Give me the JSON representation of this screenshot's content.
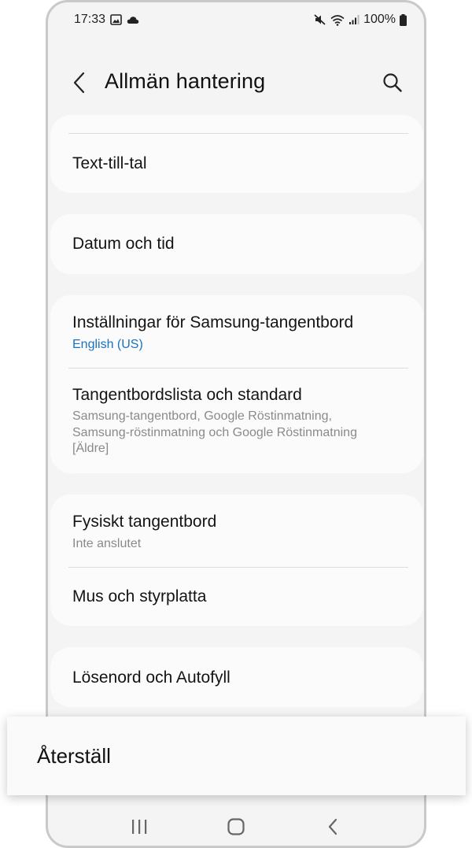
{
  "status_bar": {
    "time": "17:33",
    "battery": "100%",
    "left_icons": [
      "image-icon",
      "cloud-icon"
    ],
    "right_icons": [
      "mute-icon",
      "wifi-icon",
      "signal-icon",
      "battery-icon"
    ]
  },
  "header": {
    "title": "Allmän hantering",
    "back_icon": "chevron-left-icon",
    "search_icon": "search-icon"
  },
  "groups": [
    {
      "items": [
        {
          "title": "Text-till-tal"
        }
      ]
    },
    {
      "items": [
        {
          "title": "Datum och tid"
        }
      ]
    },
    {
      "items": [
        {
          "title": "Inställningar för Samsung-tangentbord",
          "subtitle": "English (US)"
        },
        {
          "title": "Tangentbordslista och standard",
          "subtitle_lines": [
            "Samsung-tangentbord, Google Röstinmatning,",
            "Samsung-röstinmatning och Google Röstinmatning",
            "[Äldre]"
          ]
        }
      ]
    },
    {
      "items": [
        {
          "title": "Fysiskt tangentbord",
          "subtitle": "Inte anslutet"
        },
        {
          "title": "Mus och styrplatta"
        }
      ]
    },
    {
      "items": [
        {
          "title": "Lösenord och Autofyll"
        }
      ]
    }
  ],
  "reset": {
    "label": "Återställ"
  },
  "nav_bar": {
    "icons": [
      "recents-icon",
      "home-icon",
      "back-icon"
    ]
  },
  "colors": {
    "background": "#f4f4f4",
    "card": "#fbfbfb",
    "accent": "#1a73c0",
    "subtitle": "#8a8a8a"
  }
}
